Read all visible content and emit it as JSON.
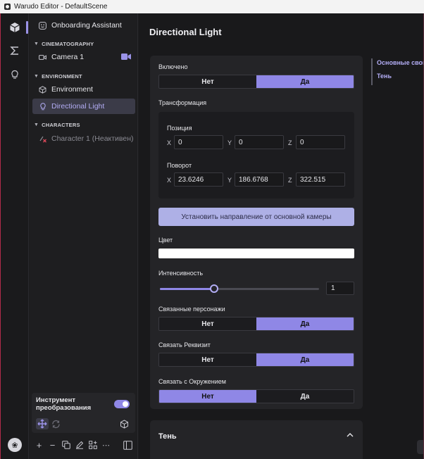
{
  "window": {
    "title": "Warudo Editor - DefaultScene"
  },
  "rail": {
    "items": [
      "cube-icon",
      "sigma-icon",
      "lightbulb-icon"
    ],
    "bottom_icon": "app-logo-icon"
  },
  "sidebar": {
    "onboarding": "Onboarding Assistant",
    "sections": {
      "cinematography": "CINEMATOGRAPHY",
      "environment": "ENVIRONMENT",
      "characters": "CHARACTERS"
    },
    "items": {
      "camera": "Camera 1",
      "environment": "Environment",
      "light": "Directional Light",
      "character": "Character 1 (Неактивен)"
    }
  },
  "tool_panel": {
    "title": "Инструмент преобразования",
    "toggle_on": true
  },
  "main": {
    "title": "Directional Light",
    "enabled": {
      "label": "Включено",
      "no": "Нет",
      "yes": "Да",
      "value": "yes"
    },
    "transform": {
      "label": "Трансформация",
      "position": {
        "label": "Позиция",
        "x": "0",
        "y": "0",
        "z": "0"
      },
      "rotation": {
        "label": "Поворот",
        "x": "23.6246",
        "y": "186.6768",
        "z": "322.515"
      },
      "axis": {
        "x": "X",
        "y": "Y",
        "z": "Z"
      }
    },
    "set_direction_button": "Установить направление от основной камеры",
    "color": {
      "label": "Цвет",
      "value": "#ffffff"
    },
    "intensity": {
      "label": "Интенсивность",
      "value": "1",
      "slider_fraction": 0.34
    },
    "linked_characters": {
      "label": "Связанные персонажи",
      "no": "Нет",
      "yes": "Да",
      "value": "yes"
    },
    "link_props": {
      "label": "Связать Реквизит",
      "no": "Нет",
      "yes": "Да",
      "value": "yes"
    },
    "link_environment": {
      "label": "Связать с Окружением",
      "no": "Нет",
      "yes": "Да",
      "value": "no"
    },
    "shadow_section": "Тень"
  },
  "toc": {
    "items": [
      "Основные свой",
      "Тень"
    ]
  },
  "colors": {
    "accent": "#8f87e6",
    "accent_light": "#b3adf5",
    "button": "#aeb0e6"
  }
}
